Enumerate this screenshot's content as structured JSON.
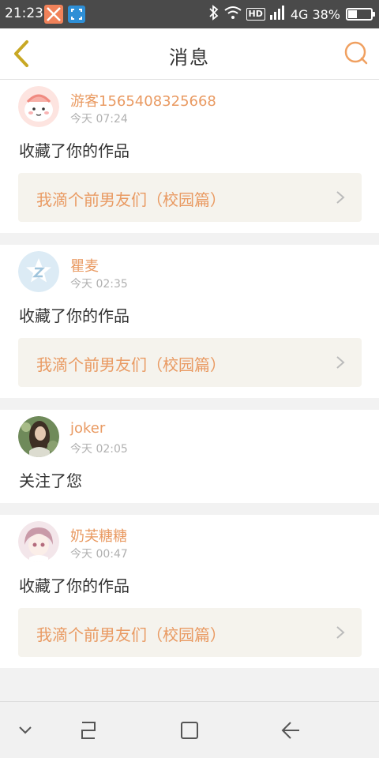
{
  "status_bar": {
    "time": "21:23",
    "network": "4G",
    "battery": "38%",
    "battery_level": 0.38,
    "hd_label": "HD",
    "icons": [
      "app-icon-x",
      "screenshot-icon",
      "bluetooth-icon",
      "wifi-icon",
      "hd-icon",
      "signal-icon",
      "battery-icon"
    ]
  },
  "header": {
    "title": "消息",
    "back_icon": "chevron-left-icon",
    "search_icon": "search-icon",
    "accent_color": "#e99a62"
  },
  "messages": [
    {
      "username": "游客1565408325668",
      "time": "今天 07:24",
      "action": "收藏了你的作品",
      "work_title": "我滴个前男友们（校园篇）",
      "avatar": "cartoon-blob-avatar"
    },
    {
      "username": "瞿麦",
      "time": "今天 02:35",
      "action": "收藏了你的作品",
      "work_title": "我滴个前男友们（校园篇）",
      "avatar": "qq-default-avatar"
    },
    {
      "username": "joker",
      "time": "今天 02:05",
      "action": "关注了您",
      "work_title": null,
      "avatar": "photo-avatar"
    },
    {
      "username": "奶芙糖糖",
      "time": "今天 00:47",
      "action": "收藏了你的作品",
      "work_title": "我滴个前男友们（校园篇）",
      "avatar": "anime-girl-avatar"
    }
  ],
  "nav_bar": {
    "buttons": [
      "hide-nav-icon",
      "recent-apps-icon",
      "home-icon",
      "back-arrow-icon"
    ]
  }
}
